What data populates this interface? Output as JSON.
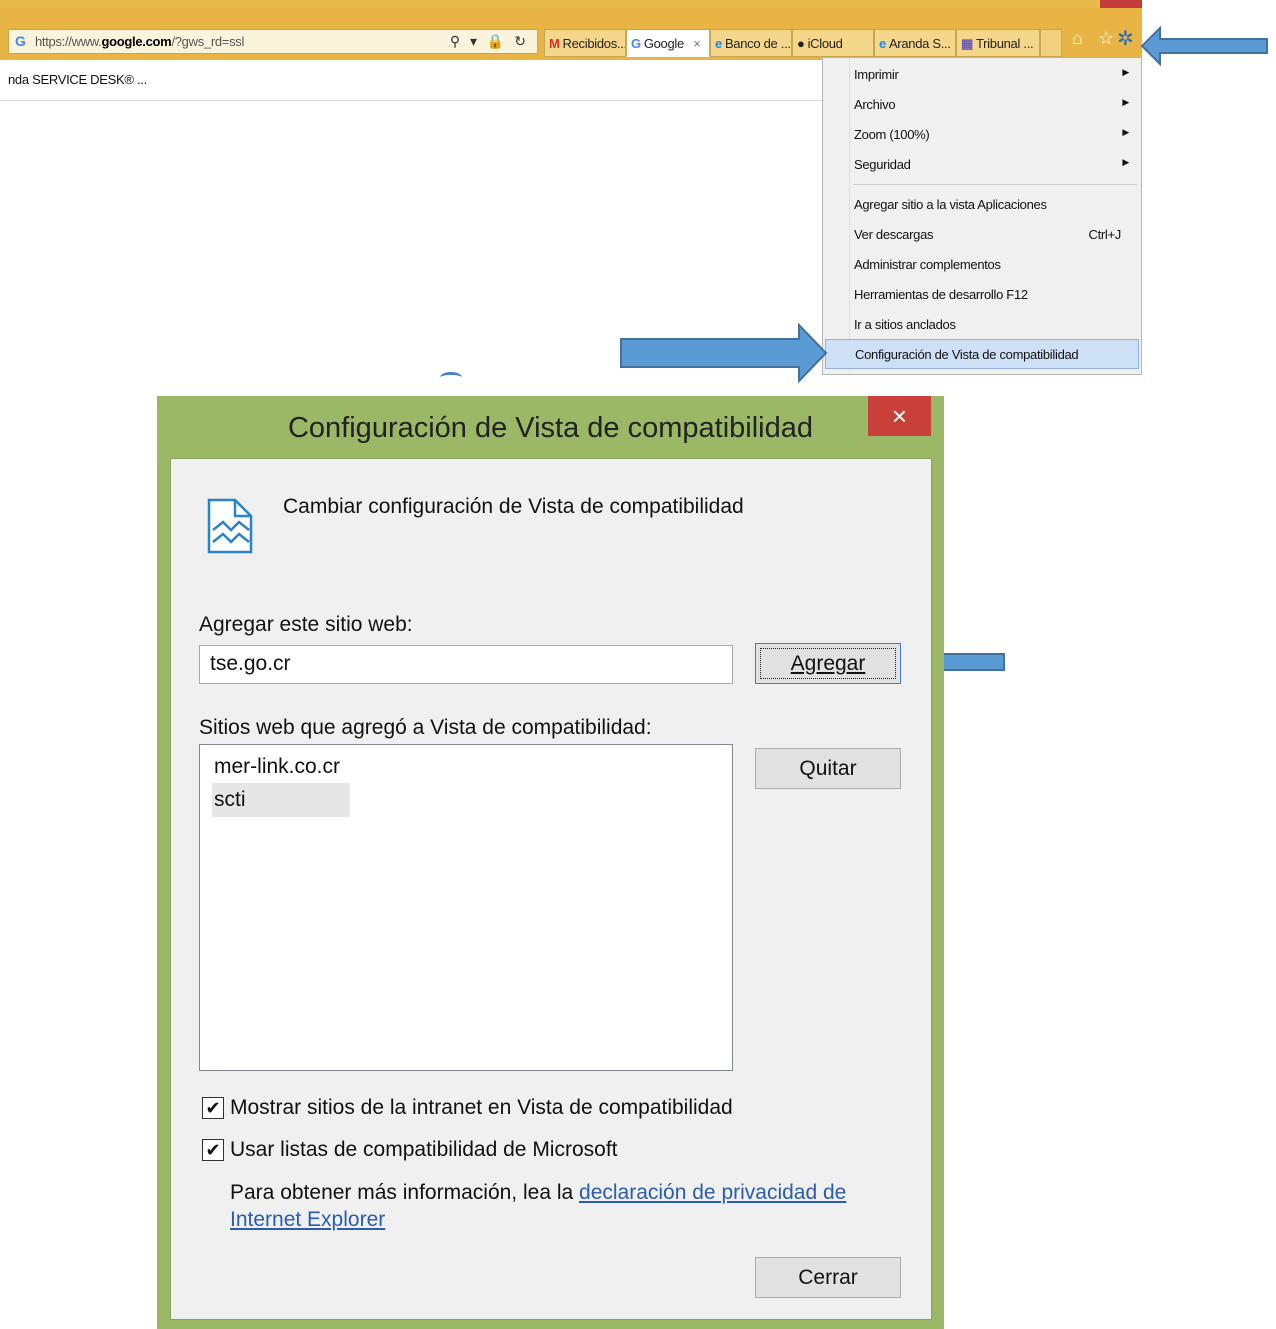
{
  "browser": {
    "address_url_prefix": "https://www.",
    "address_url_domain": "google.com",
    "address_url_suffix": "/?gws_rd=ssl",
    "address_icons": "⚲ ▾ 🔒 ↻",
    "tabs": [
      {
        "icon": "M",
        "label": "Recibidos..."
      },
      {
        "icon": "G",
        "label": "Google"
      },
      {
        "icon": "e",
        "label": "Banco de ..."
      },
      {
        "icon": "",
        "label": "iCloud"
      },
      {
        "icon": "e",
        "label": "Aranda S..."
      },
      {
        "icon": "▦",
        "label": "Tribunal ..."
      }
    ],
    "active_tab_close": "×",
    "toolbar_icons": "⌂ ☆",
    "gear": "✲",
    "favorite": "nda SERVICE DESK® ..."
  },
  "menu": {
    "items": [
      {
        "label": "Imprimir",
        "arrow": "▶"
      },
      {
        "label": "Archivo",
        "arrow": "▶"
      },
      {
        "label": "Zoom (100%)",
        "arrow": "▶"
      },
      {
        "label": "Seguridad",
        "arrow": "▶"
      },
      {
        "label": "Agregar sitio a la vista Aplicaciones"
      },
      {
        "label": "Ver descargas",
        "shortcut": "Ctrl+J"
      },
      {
        "label": "Administrar complementos"
      },
      {
        "label": "Herramientas de desarrollo F12"
      },
      {
        "label": "Ir a sitios anclados"
      },
      {
        "label": "Configuración de Vista de compatibilidad"
      }
    ]
  },
  "dialog": {
    "title": "Configuración de Vista de compatibilidad",
    "close": "×",
    "heading": "Cambiar configuración de Vista de compatibilidad",
    "add_label": "Agregar este sitio web:",
    "add_value": "tse.go.cr",
    "add_button": "Agregar",
    "list_label": "Sitios web que agregó a Vista de compatibilidad:",
    "sites": [
      "mer-link.co.cr",
      "scti"
    ],
    "remove_button": "Quitar",
    "check1": "Mostrar sitios de la intranet en Vista de compatibilidad",
    "check2": "Usar listas de compatibilidad de Microsoft",
    "check_mark": "✔",
    "info_text": "Para obtener más información, lea la ",
    "info_link": "declaración de privacidad de Internet Explorer",
    "close_button": "Cerrar"
  },
  "colors": {
    "arrow": "#5b9bd5",
    "arrow_border": "#41719c",
    "dialog_frame": "#9ab865",
    "close_red": "#c9403a"
  }
}
